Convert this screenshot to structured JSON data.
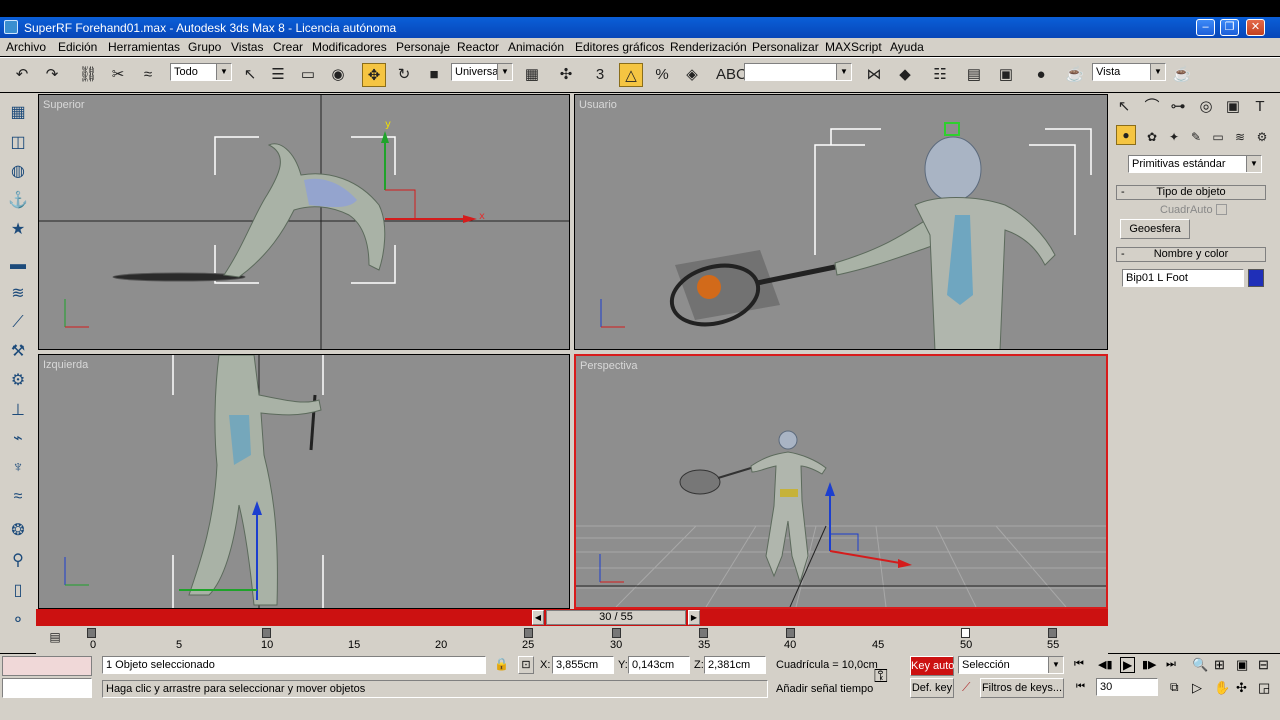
{
  "window": {
    "title": "SuperRF Forehand01.max - Autodesk 3ds Max 8  -  Licencia autónoma",
    "minimize": "–",
    "maximize": "❐",
    "close": "✕"
  },
  "menu": [
    "Archivo",
    "Edición",
    "Herramientas",
    "Grupo",
    "Vistas",
    "Crear",
    "Modificadores",
    "Personaje",
    "Reactor",
    "Animación",
    "Editores gráficos",
    "Renderización",
    "Personalizar",
    "MAXScript",
    "Ayuda"
  ],
  "toolbar": {
    "selection_filter": "Todo",
    "coord_system": "Universal",
    "named_selection": "",
    "render_type": "Vista"
  },
  "viewports": {
    "top": "Superior",
    "user": "Usuario",
    "left": "Izquierda",
    "perspective": "Perspectiva"
  },
  "command_panel": {
    "category": "Primitivas estándar",
    "rollout_object_type": "Tipo de objeto",
    "autogrid": "CuadrAuto",
    "geosphere_button": "Geoesfera",
    "rollout_name_color": "Nombre y color",
    "object_name": "Bip01 L Foot",
    "object_color": "#1f2fb8"
  },
  "timeline": {
    "slider": "30 / 55",
    "ticks": [
      "0",
      "5",
      "10",
      "15",
      "20",
      "25",
      "30",
      "35",
      "40",
      "45",
      "50",
      "55"
    ]
  },
  "status": {
    "selected": "1 Objeto seleccionado",
    "prompt": "Haga clic y arrastre para seleccionar y mover objetos",
    "x_label": "X:",
    "x": "3,855cm",
    "y_label": "Y:",
    "y": "0,143cm",
    "z_label": "Z:",
    "z": "2,381cm",
    "grid": "Cuadrícula = 10,0cm",
    "add_time_tag": "Añadir señal tiempo",
    "key_auto": "Key auto",
    "key_set": "Def. key",
    "selection_set": "Selección",
    "key_filters": "Filtros de keys...",
    "current_frame": "30"
  }
}
